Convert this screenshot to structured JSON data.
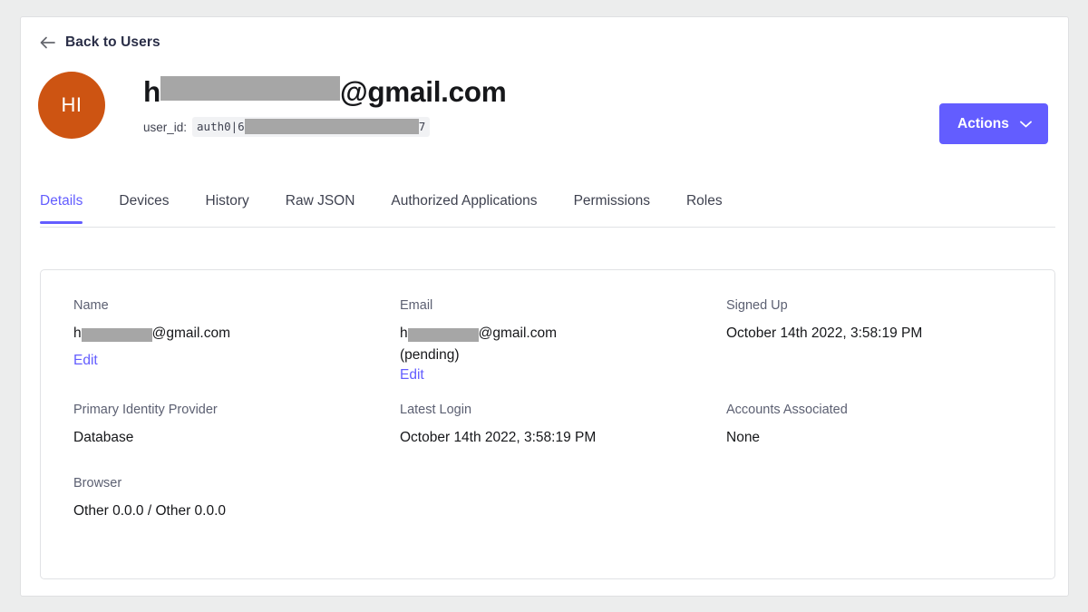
{
  "nav": {
    "back_label": "Back to Users",
    "back_icon": "arrow-left-icon"
  },
  "header": {
    "avatar_initials": "HI",
    "avatar_color": "#cd5412",
    "title_prefix": "h",
    "title_suffix": "@gmail.com",
    "user_id_label": "user_id:",
    "user_id_prefix": "auth0|6",
    "user_id_suffix": "7",
    "actions_label": "Actions",
    "actions_icon": "chevron-down-icon",
    "actions_color": "#635dff"
  },
  "tabs": [
    {
      "label": "Details",
      "active": true
    },
    {
      "label": "Devices",
      "active": false
    },
    {
      "label": "History",
      "active": false
    },
    {
      "label": "Raw JSON",
      "active": false
    },
    {
      "label": "Authorized Applications",
      "active": false
    },
    {
      "label": "Permissions",
      "active": false
    },
    {
      "label": "Roles",
      "active": false
    }
  ],
  "details": {
    "name": {
      "label": "Name",
      "value_prefix": "h",
      "value_suffix": "@gmail.com",
      "edit_label": "Edit"
    },
    "email": {
      "label": "Email",
      "value_prefix": "h",
      "value_suffix": "@gmail.com",
      "pending": "(pending)",
      "edit_label": "Edit"
    },
    "signed_up": {
      "label": "Signed Up",
      "value": "October 14th 2022, 3:58:19 PM"
    },
    "primary_identity_provider": {
      "label": "Primary Identity Provider",
      "value": "Database"
    },
    "latest_login": {
      "label": "Latest Login",
      "value": "October 14th 2022, 3:58:19 PM"
    },
    "accounts_associated": {
      "label": "Accounts Associated",
      "value": "None"
    },
    "browser": {
      "label": "Browser",
      "value": "Other 0.0.0 / Other 0.0.0"
    }
  }
}
